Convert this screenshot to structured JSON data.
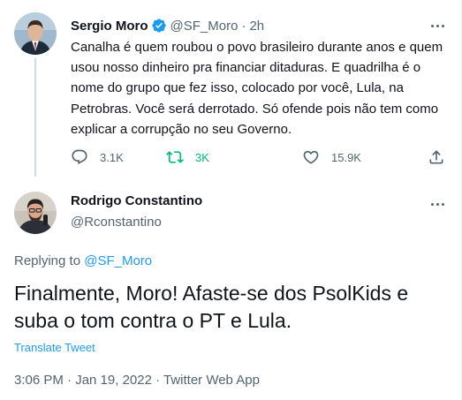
{
  "parent_tweet": {
    "author_name": "Sergio Moro",
    "verified_icon": "verified-badge-icon",
    "handle": "@SF_Moro",
    "separator": "·",
    "time": "2h",
    "text": "Canalha é quem roubou o povo brasileiro durante anos e quem usou nosso dinheiro pra financiar ditaduras. E quadrilha é o nome do grupo que fez isso, colocado por você, Lula, na Petrobras. Você será derrotado. Só ofende pois não tem como explicar a corrupção no seu Governo.",
    "actions": {
      "reply_count": "3.1K",
      "retweet_count": "3K",
      "like_count": "15.9K"
    }
  },
  "main_tweet": {
    "author_name": "Rodrigo Constantino",
    "handle": "@Rconstantino",
    "replying_prefix": "Replying to ",
    "replying_handle": "@SF_Moro",
    "text": "Finalmente, Moro! Afaste-se dos PsolKids e suba o tom contra o PT e Lula.",
    "translate_label": "Translate Tweet",
    "meta": "3:06 PM · Jan 19, 2022 · Twitter Web App"
  },
  "colors": {
    "accent": "#1d9bf0",
    "retweet_green": "#00ba7c",
    "secondary_text": "#536471",
    "primary_text": "#0f1419"
  }
}
